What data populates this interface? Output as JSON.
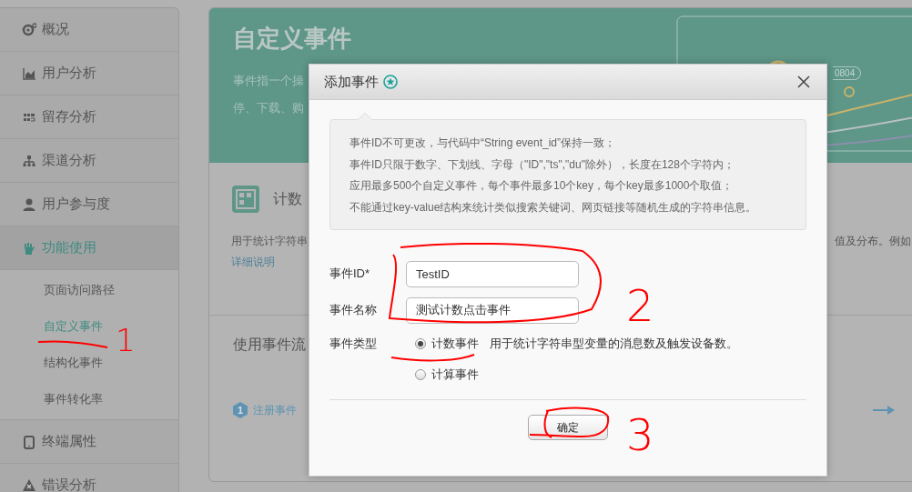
{
  "sidebar": {
    "items": [
      {
        "label": "概况",
        "selected": false
      },
      {
        "label": "用户分析",
        "selected": false
      },
      {
        "label": "留存分析",
        "selected": false
      },
      {
        "label": "渠道分析",
        "selected": false
      },
      {
        "label": "用户参与度",
        "selected": false
      },
      {
        "label": "功能使用",
        "selected": true,
        "children": [
          {
            "label": "页面访问路径",
            "selected": false
          },
          {
            "label": "自定义事件",
            "selected": true
          },
          {
            "label": "结构化事件",
            "selected": false
          },
          {
            "label": "事件转化率",
            "selected": false
          }
        ]
      },
      {
        "label": "终端属性",
        "selected": false
      },
      {
        "label": "错误分析",
        "selected": false
      }
    ]
  },
  "page": {
    "title": "自定义事件",
    "description_lines": [
      "事件指一个操",
      "停、下载、购"
    ],
    "banner_label": "0804",
    "card": {
      "title": "计数",
      "description": "用于统计字符串",
      "description_tail": "值及分布。例如",
      "link": "详细说明"
    },
    "flow": {
      "title": "使用事件流",
      "steps": [
        {
          "number": "1",
          "label": "注册事件"
        }
      ]
    }
  },
  "dialog": {
    "title": "添加事件",
    "notes": [
      "事件ID不可更改，与代码中“String event_id”保持一致；",
      "事件ID只限于数字、下划线、字母（\"ID\",\"ts\",\"du\"除外），长度在128个字符内；",
      "应用最多500个自定义事件，每个事件最多10个key，每个key最多1000个取值；",
      "不能通过key-value结构来统计类似搜索关键词、网页链接等随机生成的字符串信息。"
    ],
    "fields": [
      {
        "label": "事件ID*",
        "value": "TestID"
      },
      {
        "label": "事件名称",
        "value": "测试计数点击事件"
      }
    ],
    "type_label": "事件类型",
    "options": [
      {
        "label": "计数事件",
        "selected": true,
        "hint": "用于统计字符串型变量的消息数及触发设备数。"
      },
      {
        "label": "计算事件",
        "selected": false
      }
    ],
    "confirm": "确定"
  },
  "annotations": [
    {
      "text": "1"
    },
    {
      "text": "2"
    },
    {
      "text": "3"
    }
  ]
}
